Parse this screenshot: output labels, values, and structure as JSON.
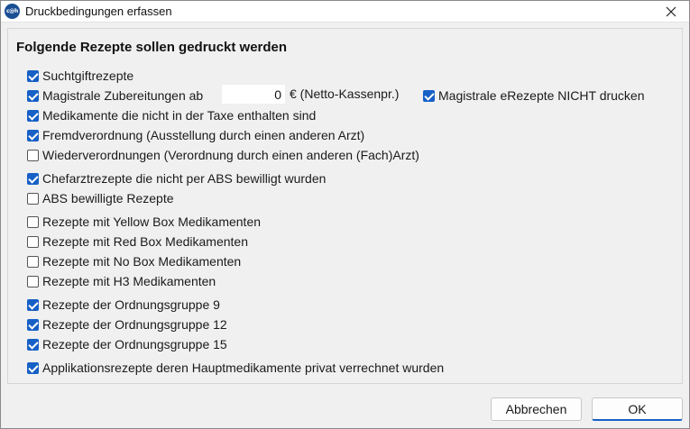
{
  "window": {
    "title": "Druckbedingungen erfassen",
    "app_icon_text": "c@h",
    "close_symbol": "×"
  },
  "section": {
    "heading": "Folgende Rezepte sollen gedruckt werden"
  },
  "options": [
    {
      "label": "Suchtgiftrezepte",
      "checked": true
    },
    {
      "label": "Magistrale Zubereitungen ab",
      "checked": true
    },
    {
      "label": "Magistrale eRezepte NICHT drucken",
      "checked": true
    },
    {
      "label": "Medikamente die nicht in der Taxe enthalten sind",
      "checked": true
    },
    {
      "label": "Fremdverordnung (Ausstellung durch einen anderen Arzt)",
      "checked": true
    },
    {
      "label": "Wiederverordnungen (Verordnung durch einen anderen (Fach)Arzt)",
      "checked": false
    },
    {
      "label": "Chefarztrezepte die nicht per ABS bewilligt wurden",
      "checked": true
    },
    {
      "label": "ABS bewilligte Rezepte",
      "checked": false
    },
    {
      "label": "Rezepte mit Yellow Box Medikamenten",
      "checked": false
    },
    {
      "label": "Rezepte mit Red Box Medikamenten",
      "checked": false
    },
    {
      "label": "Rezepte mit No Box Medikamenten",
      "checked": false
    },
    {
      "label": "Rezepte mit H3 Medikamenten",
      "checked": false
    },
    {
      "label": "Rezepte der Ordnungsgruppe 9",
      "checked": true
    },
    {
      "label": "Rezepte der Ordnungsgruppe 12",
      "checked": true
    },
    {
      "label": "Rezepte der Ordnungsgruppe 15",
      "checked": true
    },
    {
      "label": "Applikationsrezepte deren Hauptmedikamente privat verrechnet wurden",
      "checked": true
    }
  ],
  "magistral_threshold": {
    "value": "0",
    "unit_label": "€ (Netto-Kassenpr.)"
  },
  "buttons": {
    "cancel": "Abbrechen",
    "ok": "OK"
  },
  "colors": {
    "accent": "#1760c6",
    "dialog_background": "#f0f0f0",
    "titlebar_background": "#ffffff"
  }
}
